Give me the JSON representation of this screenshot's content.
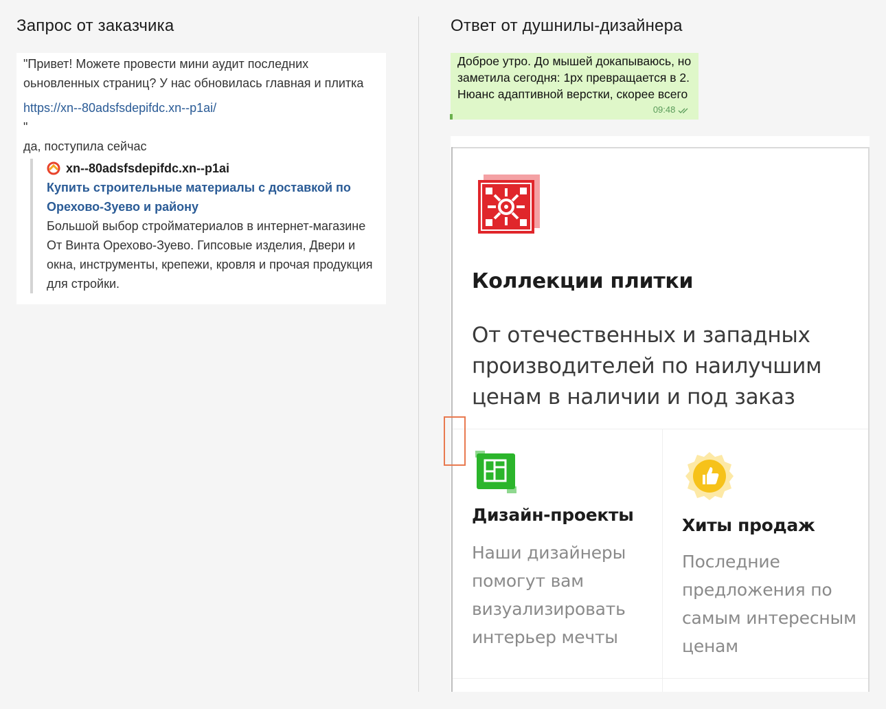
{
  "left": {
    "title": "Запрос от заказчика",
    "message": "\"Привет! Можете провести мини аудит последних оьновленных страниц? У нас обновилась главная и плитка",
    "link": "https://xn--80adsfsdepifdc.xn--p1ai/",
    "quote_end": "\"",
    "reply": "да, поступила сейчас",
    "preview": {
      "site": "xn--80adsfsdepifdc.xn--p1ai",
      "title": "Купить строительные материалы с доставкой по Орехово-Зуево и району",
      "description": "Большой выбор стройматериалов в интернет-магазине От Винта Орехово-Зуево. Гипсовые изделия, Двери и окна, инструменты, крепежи, кровля и прочая продукция для стройки."
    }
  },
  "right": {
    "title": "Ответ от душнилы-дизайнера",
    "bubble": {
      "text": "Доброе утро. До мышей докапываюсь, но заметила сегодня: 1рх превращается в 2. Нюанс адаптивной верстки, скорее всего",
      "time": "09:48"
    },
    "mockup": {
      "heading": "Коллекции плитки",
      "subheading": "От отечественных и западных производителей по наилучшим ценам в наличии и под заказ",
      "features": [
        {
          "title": "Дизайн-проекты",
          "description": "Наши дизайнеры помогут вам визуализировать интерьер мечты",
          "icon": "design-grid-icon"
        },
        {
          "title": "Хиты продаж",
          "description": "Последние предложения по самым интересным ценам",
          "icon": "thumbs-up-badge-icon"
        }
      ]
    }
  },
  "colors": {
    "link": "#2a5b96",
    "bubble_bg": "#dff7c9",
    "highlight": "#e8794f",
    "logo_red": "#e0262b",
    "design_green": "#2bb52b",
    "hits_yellow": "#f6c21a"
  }
}
